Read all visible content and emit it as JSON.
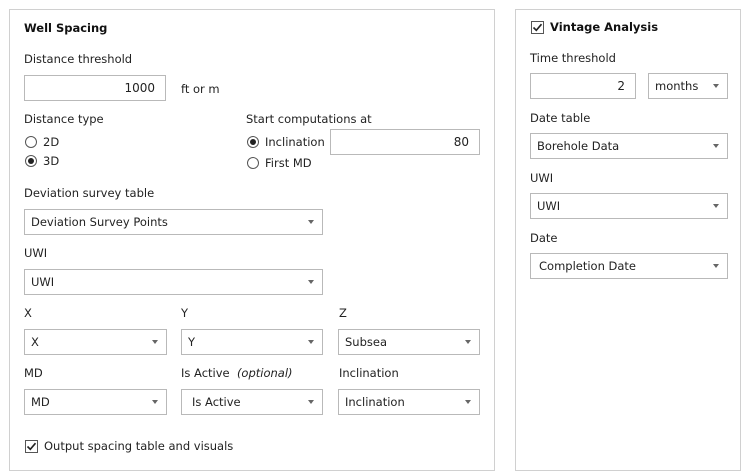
{
  "well_spacing": {
    "title": "Well Spacing",
    "distance_threshold": {
      "label": "Distance threshold",
      "value": "1000",
      "unit": "ft or m"
    },
    "distance_type": {
      "label": "Distance type",
      "options": [
        {
          "label": "2D",
          "selected": false
        },
        {
          "label": "3D",
          "selected": true
        }
      ]
    },
    "start_computations": {
      "label": "Start computations at",
      "options": [
        {
          "label": "Inclination",
          "selected": true
        },
        {
          "label": "First MD",
          "selected": false
        }
      ],
      "inclination_value": "80"
    },
    "deviation_survey_table": {
      "label": "Deviation survey table",
      "value": "Deviation Survey Points"
    },
    "uwi": {
      "label": "UWI",
      "value": "UWI"
    },
    "x": {
      "label": "X",
      "value": "X"
    },
    "y": {
      "label": "Y",
      "value": "Y"
    },
    "z": {
      "label": "Z",
      "value": "Subsea"
    },
    "md": {
      "label": "MD",
      "value": "MD"
    },
    "is_active": {
      "label": "Is Active",
      "optional": "(optional)",
      "value": "Is Active"
    },
    "inclination": {
      "label": "Inclination",
      "value": "Inclination"
    },
    "output_checkbox": {
      "label": "Output spacing table and visuals",
      "checked": true
    }
  },
  "vintage": {
    "title": "Vintage Analysis",
    "checked": true,
    "time_threshold": {
      "label": "Time threshold",
      "value": "2",
      "unit": "months"
    },
    "date_table": {
      "label": "Date table",
      "value": "Borehole Data"
    },
    "uwi": {
      "label": "UWI",
      "value": "UWI"
    },
    "date": {
      "label": "Date",
      "value": "Completion Date"
    }
  }
}
